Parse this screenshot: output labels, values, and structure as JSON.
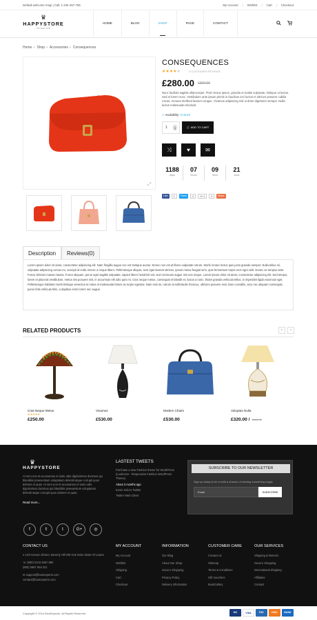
{
  "topbar": {
    "welcome": "Default welcome msg! | Call: 1-234-457-756",
    "links": [
      "My Account",
      "Wishlist",
      "Cart",
      "Checkout"
    ]
  },
  "header": {
    "logo_name": "HAPPYSTORE",
    "logo_sub": "INTERIOR",
    "nav": [
      "HOME",
      "BLOG",
      "SHOP",
      "PAGE",
      "CONTACT"
    ],
    "active": "SHOP"
  },
  "breadcrumb": [
    "Home",
    "Shop",
    "Accessories",
    "Consequences"
  ],
  "product": {
    "title": "CONSEQUENCES",
    "rating": 4,
    "reviews": "0 CUSTOMER REVIEWS",
    "price": "£280.00",
    "old_price": "£300.00",
    "description": "Nunc facilisis sagittis ullamcorper. Proin lectus ipsum, gravida et mattis vulputate, tristique ut lectus. Sed et lorem nunc. Vestibulum ante ipsum primis in faucibus orci luctus et ultrices posuere cubilia Curae; Aenean eleifend laoreet congue. Vivamus adipiscing nisl ut dolor dignissim semper. Nulla luctus malesuada tincidunt.",
    "availability_label": "Availability:",
    "availability_value": "In stock",
    "qty": "1",
    "add_to_cart": "ADD TO CART",
    "countdown": [
      {
        "n": "1188",
        "l": "days"
      },
      {
        "n": "07",
        "l": "hours"
      },
      {
        "n": "09",
        "l": "mins"
      },
      {
        "n": "21",
        "l": "secs"
      }
    ],
    "social": {
      "like": "Like",
      "like_count": "0",
      "tweet": "Tweet",
      "tweet_count": "0",
      "gplus": "G+1",
      "gplus_count": "0",
      "share": "Share"
    }
  },
  "tabs": {
    "description": "Description",
    "reviews": "Reviews(0)",
    "body": "Lorem ipsum dolor sit amet, consectetur adipiscing elit. Nam fringilla augue nec est tristique auctor. Donec non est at libero vulputate rutrum. Morbi ornare lectus quis justo gravida semper. Nulla tellus mi, vulputate adipiscing cursus eu, suscipit id nulla. Donec a neque libero. Pellentesque aliquet, sem eget laoreet ultrices, ipsum metus feugiat sem, quis fermentum turpis eros eget velit. Donec ac tempus ante. Fusce ultricies massa massa. Fusce aliquam, purus eget sagittis vulputate, sapien libero hendrerit est, sed commodo augue nisi non neque. Lorem ipsum dolor sit amet, consectetur adipiscing elit. Sed tempor, lorem et placerat vestibulum, metus nisi posuere nisl, in accumsan elit odio quis mi. Cras neque metus, consequat et blandit et, luctus a nunc. Etiam gravida vehicula tellus, in imperdiet ligula euismod eget. Pellentesque habitant morbi tristique senectus et netus et malesuada fames ac turpis egestas. Nam erat mi, rutrum at sollicitudin rhoncus, ultricies posuere erat. Duis convallis, arcu nec aliquam consequat, purus felis vehicula felis, a dapibus enim lorem nec augue."
  },
  "related": {
    "title": "RELATED PRODUCTS",
    "items": [
      {
        "name": "Cras Neque Metus",
        "price": "£250.00",
        "old": "",
        "stars": true
      },
      {
        "name": "Vivamus",
        "price": "£530.00",
        "old": "",
        "stars": false
      },
      {
        "name": "Modem Chairs",
        "price": "£530.00",
        "old": "",
        "stars": false
      },
      {
        "name": "Voluptas Nulla",
        "price": "£320.00 /",
        "old": "£300.00",
        "stars": false
      }
    ]
  },
  "footer": {
    "logo": "HAPPYSTORE",
    "about": "At vero eos et accusamus et iusto odio dignissimos ducimus qui blanditiis praesentium voluptatum deleniti atque corrupti quos dolores et quas. At vero eos et accusamus et iusto odio dignissimos ducimus qui blanditiis praesentium voluptatum deleniti atque corrupti quos dolores et quas.",
    "read_more": "Read more...",
    "tweets_title": "LASTEST TWEETS",
    "tweet_text": "Purchase a new Fashion theme for WordPress (LookCare - Responsive Fashion WordPress Theme)",
    "tweet_when": "About 3 months ago",
    "tweet_from": "Kevin Scko's Twitter",
    "tweet_client": "Twitter Web Client",
    "news_title": "SUBSCRIBE TO OUR NEWSLETTER",
    "news_text": "Sign up today to be in with a chance of winning something magic",
    "news_placeholder": "Email",
    "news_button": "SUBSCRIBE",
    "contact_title": "CONTACT US",
    "contact": [
      "123 Hoeven Shtore, Beverly Hill OM Hok Invite State Of Lowen",
      "(800) 0123 4567 890\n(800) 0987 654 321",
      "support@bootexperts.com\ncontact@bootexperts.com"
    ],
    "columns": [
      {
        "title": "MY ACCOUNT",
        "items": [
          "My Account",
          "Wishlist",
          "Shipping",
          "Cart",
          "Checkout"
        ]
      },
      {
        "title": "INFORMATION",
        "items": [
          "Our Blog",
          "About Our Shop",
          "Secure Shopping",
          "Privacy Policy",
          "Delivery information"
        ]
      },
      {
        "title": "CUSTOMER CARE",
        "items": [
          "Contact us",
          "Sitemap",
          "Terms & Conditions",
          "Gift Vouchers",
          "BootGallery"
        ]
      },
      {
        "title": "OUR SERVICES",
        "items": [
          "Shipping & Returns",
          "Secure Shopping",
          "International Shipping",
          "Affiliates",
          "Contact"
        ]
      }
    ],
    "copyright": "Copyright © 2014 BootExperts. All Rights Reserved",
    "payments": [
      "MC",
      "VISA",
      "PAY",
      "DISC",
      "BANK"
    ]
  }
}
